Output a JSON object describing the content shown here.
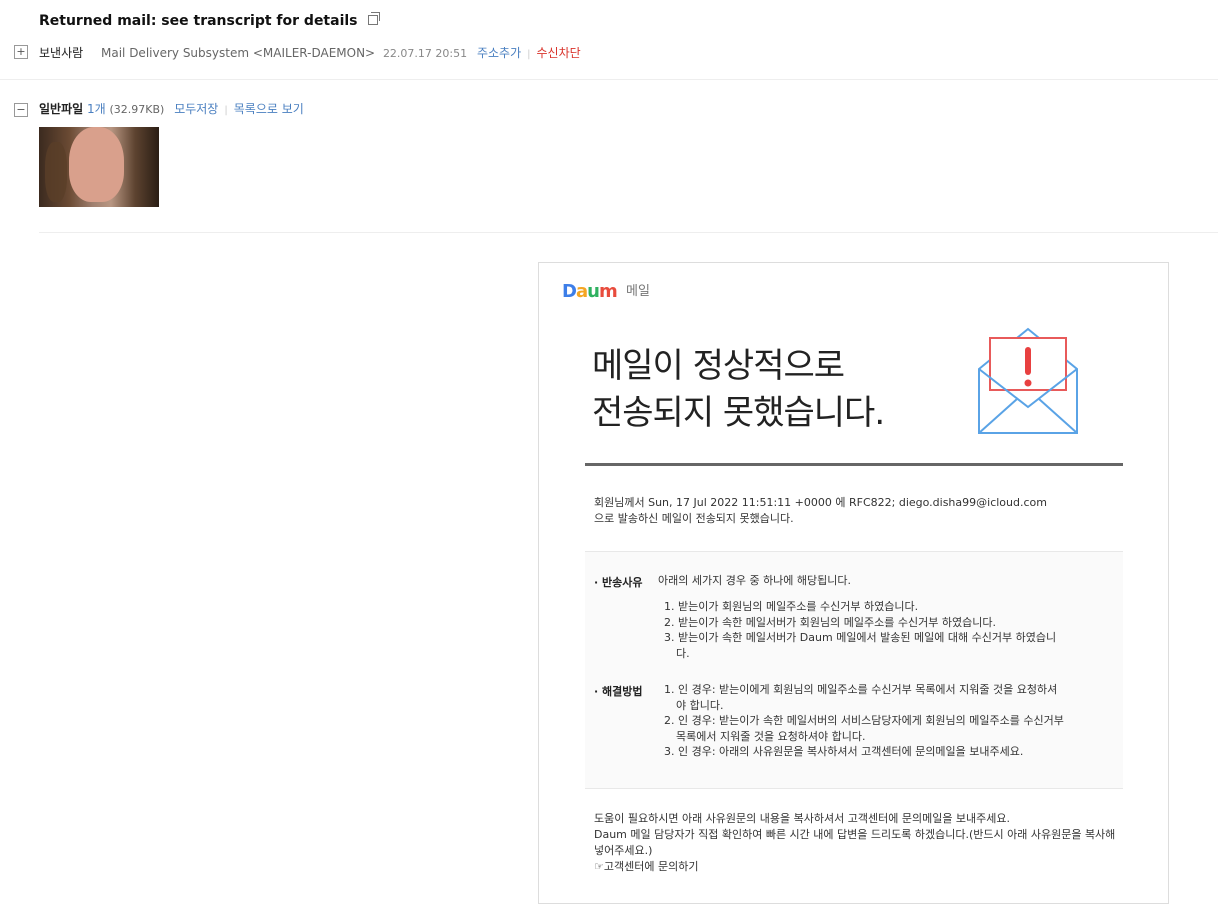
{
  "header": {
    "subject": "Returned mail: see transcript for details",
    "from_label": "보낸사람",
    "sender": "Mail Delivery Subsystem <MAILER-DAEMON>",
    "date": "22.07.17 20:51",
    "add_address": "주소추가",
    "block": "수신차단"
  },
  "attachments": {
    "label": "일반파일",
    "count": "1개",
    "size": "(32.97KB)",
    "save_all": "모두저장",
    "view_list": "목록으로 보기"
  },
  "notice": {
    "logo_text": "Daum",
    "logo_sub": "메일",
    "headline_line1": "메일이 정상적으로",
    "headline_line2": "전송되지 못했습니다.",
    "intro_line1": "회원님께서 Sun, 17 Jul 2022 11:51:11 +0000 에 RFC822; diego.disha99@icloud.com",
    "intro_line2": "으로 발송하신 메일이 전송되지 못했습니다.",
    "reason_label": "· 반송사유",
    "reason_text": "아래의 세가지 경우 중 하나에 해당됩니다.",
    "reasons": [
      "1. 받는이가 회원님의 메일주소를 수신거부 하였습니다.",
      "2. 받는이가 속한 메일서버가 회원님의 메일주소를 수신거부 하였습니다.",
      "3. 받는이가 속한 메일서버가 Daum 메일에서 발송된 메일에 대해 수신거부 하였습니다."
    ],
    "solution_label": "· 해결방법",
    "solutions": [
      "1. 인 경우: 받는이에게 회원님의 메일주소를 수신거부 목록에서 지워줄 것을 요청하셔야 합니다.",
      "2. 인 경우: 받는이가 속한 메일서버의 서비스담당자에게 회원님의 메일주소를 수신거부 목록에서 지워줄 것을 요청하셔야 합니다.",
      "3. 인 경우: 아래의 사유원문을 복사하셔서 고객센터에 문의메일을 보내주세요."
    ],
    "help_line1": "도움이 필요하시면 아래 사유원문의 내용을 복사하셔서 고객센터에 문의메일을 보내주세요.",
    "help_line2": "Daum 메일 담당자가 직접 확인하여 빠른 시간 내에 답변을 드리도록 하겠습니다.(반드시 아래 사유원문을 복사해 넣어주세요.)",
    "contact_link": "☞고객센터에 문의하기"
  },
  "colors": {
    "link": "#4a7fc0",
    "red": "#d9332b"
  }
}
